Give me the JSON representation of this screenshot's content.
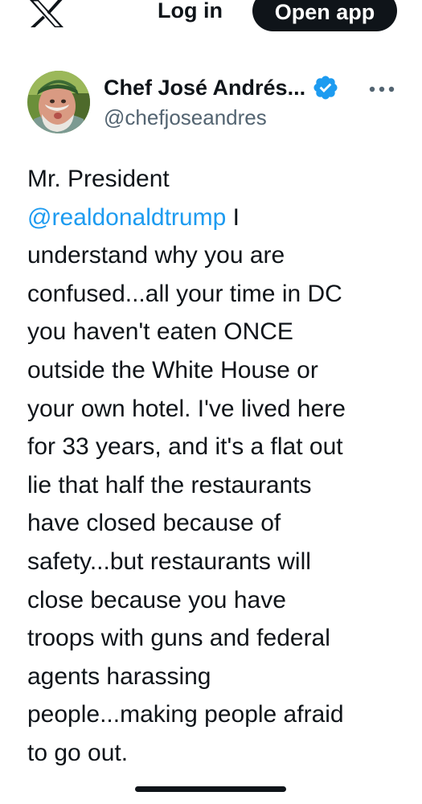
{
  "header": {
    "logo_icon": "x-logo-icon",
    "login_label": "Log in",
    "open_app_label": "Open app"
  },
  "author": {
    "name": "Chef José Andrés...",
    "handle": "@chefjoseandres",
    "verified_icon": "verified-badge-icon",
    "verified_color": "#1d9bf0",
    "more_icon": "more-options-icon"
  },
  "tweet": {
    "line_1": "Mr. President",
    "mention": "@realdonaldtrump",
    "line_2_rest": " I",
    "line_3": "understand why you are",
    "line_4": "confused...all your time in DC",
    "line_5": "you haven't eaten ONCE",
    "line_6": "outside the White House or",
    "line_7": "your own hotel. I've lived here",
    "line_8": "for 33 years, and it's a flat out",
    "line_9": "lie that half the restaurants",
    "line_10": "have closed because of",
    "line_11": "safety...but restaurants will",
    "line_12": "close because you have",
    "line_13": "troops with guns and federal",
    "line_14": "agents harassing",
    "line_15": "people...making people afraid",
    "line_16": "to go out."
  },
  "colors": {
    "text": "#0f1419",
    "secondary": "#536471",
    "link": "#1d9bf0",
    "button_bg": "#0f1419"
  }
}
